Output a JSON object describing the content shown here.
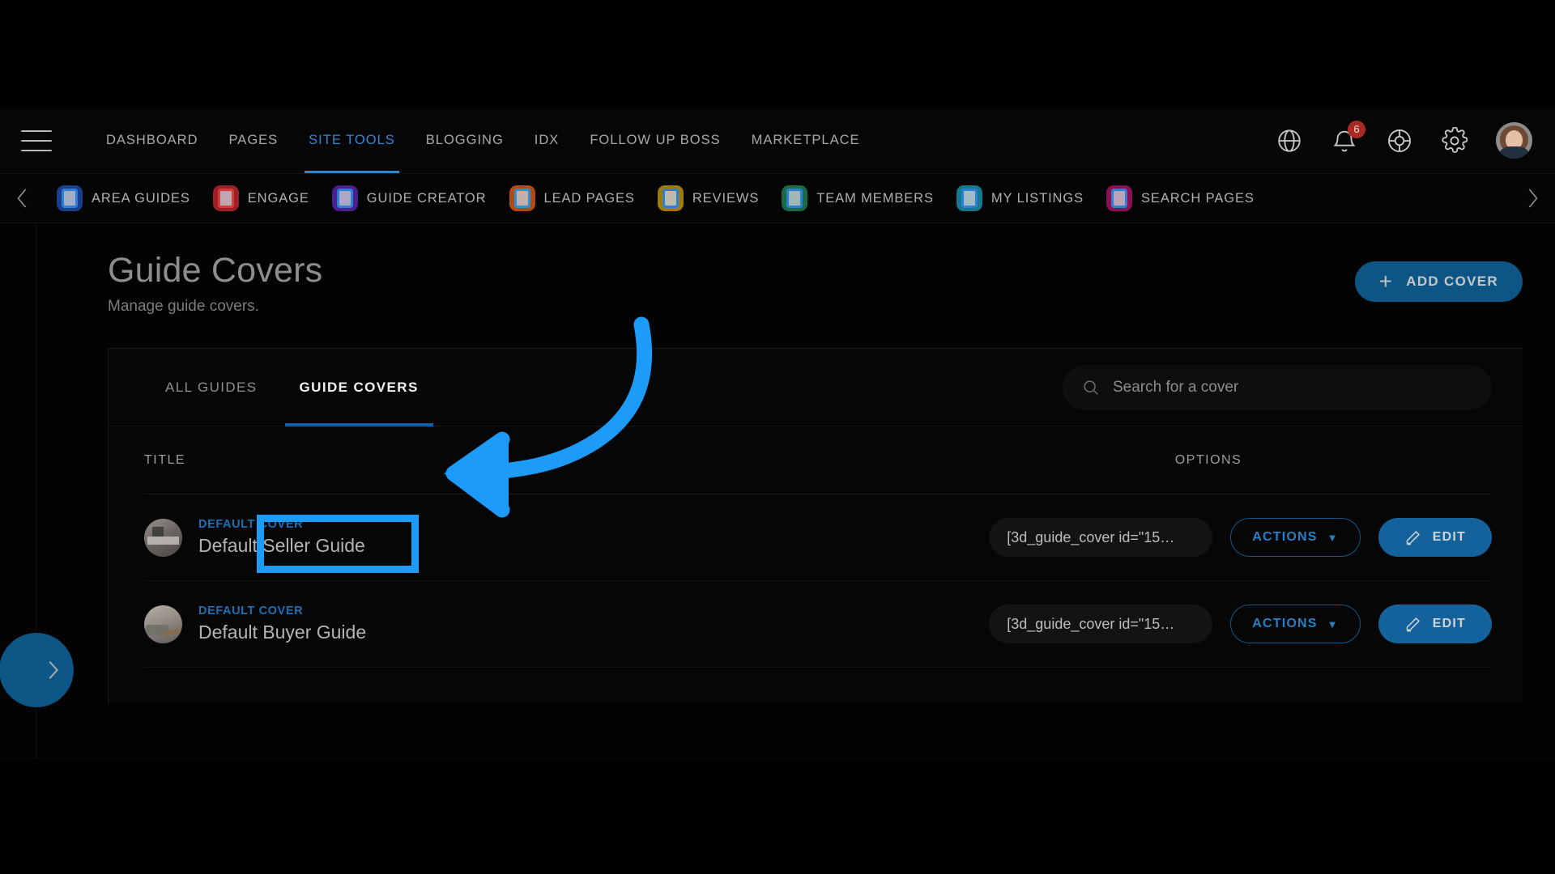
{
  "topnav": {
    "menu_icon": "hamburger-icon",
    "items": [
      {
        "label": "Dashboard",
        "active": false
      },
      {
        "label": "Pages",
        "active": false
      },
      {
        "label": "Site Tools",
        "active": true
      },
      {
        "label": "Blogging",
        "active": false
      },
      {
        "label": "IDX",
        "active": false
      },
      {
        "label": "Follow Up Boss",
        "active": false
      },
      {
        "label": "Marketplace",
        "active": false
      }
    ],
    "right_icons": [
      {
        "name": "globe-icon"
      },
      {
        "name": "bell-icon",
        "badge": "6"
      },
      {
        "name": "lifebuoy-help-icon"
      },
      {
        "name": "gear-settings-icon"
      }
    ],
    "avatar_alt": "User profile photo"
  },
  "subnav": {
    "prev_label": "‹",
    "next_label": "›",
    "items": [
      {
        "label": "Area Guides",
        "color": "#1b3f8f",
        "accent": "#2b7fd4"
      },
      {
        "label": "Engage",
        "color": "#9e1f28",
        "accent": "#d43b3b"
      },
      {
        "label": "Guide Creator",
        "color": "#4b1f8f",
        "accent": "#2b7fd4"
      },
      {
        "label": "Lead Pages",
        "color": "#b14a14",
        "accent": "#2b8fd4"
      },
      {
        "label": "Reviews",
        "color": "#9c7a10",
        "accent": "#2b7fd4"
      },
      {
        "label": "Team Members",
        "color": "#1a6b45",
        "accent": "#2b7fd4"
      },
      {
        "label": "My Listings",
        "color": "#127a8c",
        "accent": "#2b7fd4"
      },
      {
        "label": "Search Pages",
        "color": "#8c0f52",
        "accent": "#2b7fd4"
      }
    ]
  },
  "page": {
    "title": "Guide Covers",
    "subtitle": "Manage guide covers.",
    "add_button": "Add Cover",
    "add_button_icon": "plus-icon"
  },
  "card": {
    "tabs": [
      {
        "label": "All Guides",
        "active": false
      },
      {
        "label": "Guide Covers",
        "active": true
      }
    ],
    "search": {
      "placeholder": "Search for a cover",
      "value": "",
      "icon": "search-icon"
    }
  },
  "table": {
    "columns": {
      "title": "Title",
      "options": "Options"
    },
    "rows": [
      {
        "kicker": "Default Cover",
        "name": "Default Seller Guide",
        "shortcode": "[3d_guide_cover id=\"15…",
        "actions_label": "Actions",
        "edit_label": "Edit",
        "thumb_class": "seller"
      },
      {
        "kicker": "Default Cover",
        "name": "Default Buyer Guide",
        "shortcode": "[3d_guide_cover id=\"15…",
        "actions_label": "Actions",
        "edit_label": "Edit",
        "thumb_class": "buyer"
      }
    ]
  },
  "left_tab": {
    "icon": "chevron-right-icon"
  },
  "annotation": {
    "color": "#1d9bf8",
    "shape": "curved-arrow-pointing-left",
    "target": "Guide Covers"
  },
  "colors": {
    "accent_blue": "#2e87d6",
    "button_blue": "#14629c",
    "highlight_blue": "#1d9bf8",
    "badge_red": "#a92a22",
    "background": "#050505"
  }
}
